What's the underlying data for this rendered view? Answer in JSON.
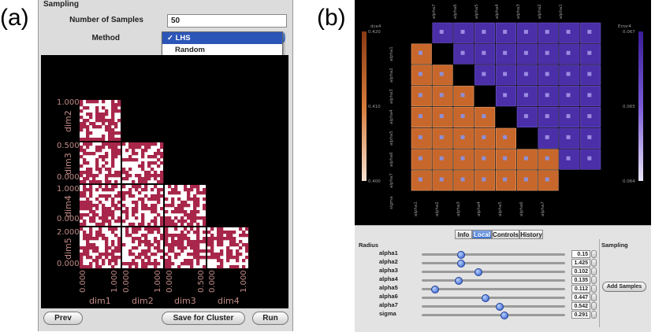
{
  "panel_a": {
    "label": "(a)",
    "section_title": "Sampling",
    "num_samples_label": "Number of Samples",
    "num_samples_value": "50",
    "method_label": "Method",
    "method_options": [
      "LHS",
      "Random"
    ],
    "method_selected": "LHS",
    "selected_check": "✓",
    "matrix": {
      "rows": [
        {
          "label": "dim2",
          "top": "1.000",
          "bottom": "0.000"
        },
        {
          "label": "dim3",
          "top": "0.500",
          "bottom": "0.000"
        },
        {
          "label": "dim4",
          "top": "1.000",
          "bottom": "0.000"
        },
        {
          "label": "dim5",
          "top": "2.000",
          "bottom": "0.000"
        }
      ],
      "cols": [
        {
          "label": "dim1",
          "left": "0.000",
          "right": "1.000"
        },
        {
          "label": "dim2",
          "left": "0.000",
          "right": "1.000"
        },
        {
          "label": "dim3",
          "left": "0.000",
          "right": "0.500"
        },
        {
          "label": "dim4",
          "left": "0.000",
          "right": "1.000"
        }
      ]
    },
    "prev_label": "Prev",
    "save_label": "Save for Cluster",
    "run_label": "Run"
  },
  "panel_b": {
    "label": "(b)",
    "left_colorbar": {
      "title": "dce4",
      "top": "0.420",
      "mid": "0.410",
      "bottom": "0.400"
    },
    "right_colorbar": {
      "title": "Error4",
      "top": "0.067",
      "mid": "0.065",
      "bottom": "0.064"
    },
    "top_axis_labels": [
      "alpha7",
      "alpha6",
      "alpha5",
      "alpha4",
      "alpha3",
      "alpha2",
      "alpha1"
    ],
    "bottom_axis_labels": [
      "alpha1",
      "alpha2",
      "alpha3",
      "alpha4",
      "alpha5",
      "alpha6",
      "alpha7"
    ],
    "left_axis_labels": [
      "alpha1",
      "alpha2",
      "alpha3",
      "alpha4",
      "alpha5",
      "alpha6",
      "alpha7",
      "sigma"
    ],
    "tabs": [
      "Info",
      "Local",
      "Controls",
      "History"
    ],
    "active_tab": "Local",
    "radius_title": "Radius",
    "sampling_title": "Sampling",
    "add_samples_label": "Add Samples",
    "sliders": [
      {
        "name": "alpha1",
        "value": "0.15",
        "pos": 0.27
      },
      {
        "name": "alpha2",
        "value": "1.425",
        "pos": 0.27
      },
      {
        "name": "alpha3",
        "value": "0.102",
        "pos": 0.39
      },
      {
        "name": "alpha4",
        "value": "0.135",
        "pos": 0.25
      },
      {
        "name": "alpha5",
        "value": "0.112",
        "pos": 0.09
      },
      {
        "name": "alpha6",
        "value": "0.447",
        "pos": 0.44
      },
      {
        "name": "alpha7",
        "value": "0.542",
        "pos": 0.54
      },
      {
        "name": "sigma",
        "value": "0.291",
        "pos": 0.57
      }
    ]
  },
  "colors": {
    "maroon": "#a8264a",
    "orange": "#c8672b",
    "purple": "#5a3ab8",
    "tick_text": "#c08a86"
  }
}
